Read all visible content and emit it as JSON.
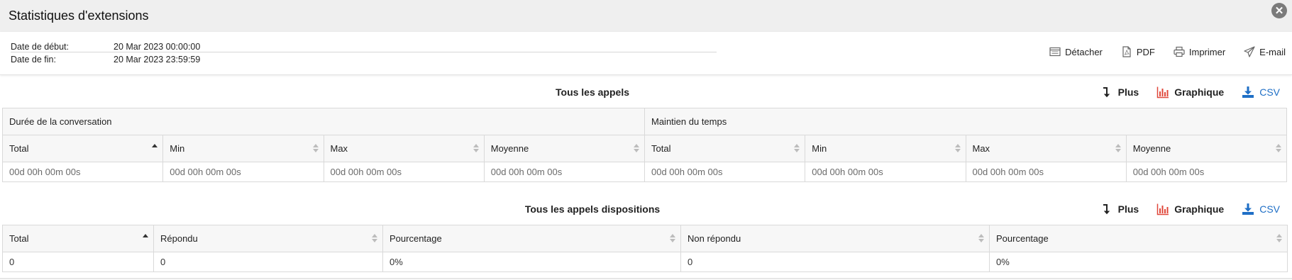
{
  "window": {
    "title": "Statistiques d'extensions",
    "close_icon": "close-icon"
  },
  "info": {
    "start_label": "Date de début:",
    "start_value": "20 Mar 2023 00:00:00",
    "end_label": "Date de fin:",
    "end_value": "20 Mar 2023 23:59:59"
  },
  "actions": {
    "detach": "Détacher",
    "pdf": "PDF",
    "print": "Imprimer",
    "email": "E-mail"
  },
  "section1": {
    "title": "Tous les appels",
    "more": "Plus",
    "chart": "Graphique",
    "csv": "CSV",
    "groups": [
      "Durée de la conversation",
      "Maintien du temps"
    ],
    "columns": [
      "Total",
      "Min",
      "Max",
      "Moyenne",
      "Total",
      "Min",
      "Max",
      "Moyenne"
    ],
    "row": [
      "00d 00h 00m 00s",
      "00d 00h 00m 00s",
      "00d 00h 00m 00s",
      "00d 00h 00m 00s",
      "00d 00h 00m 00s",
      "00d 00h 00m 00s",
      "00d 00h 00m 00s",
      "00d 00h 00m 00s"
    ]
  },
  "section2": {
    "title": "Tous les appels dispositions",
    "more": "Plus",
    "chart": "Graphique",
    "csv": "CSV",
    "columns": [
      "Total",
      "Répondu",
      "Pourcentage",
      "Non répondu",
      "Pourcentage"
    ],
    "row": [
      "0",
      "0",
      "0%",
      "0",
      "0%"
    ]
  },
  "colors": {
    "accent_blue": "#1f6fc6",
    "chart_red": "#e0473a",
    "header_bg": "#f7f7f7",
    "title_bg": "#efefef"
  }
}
